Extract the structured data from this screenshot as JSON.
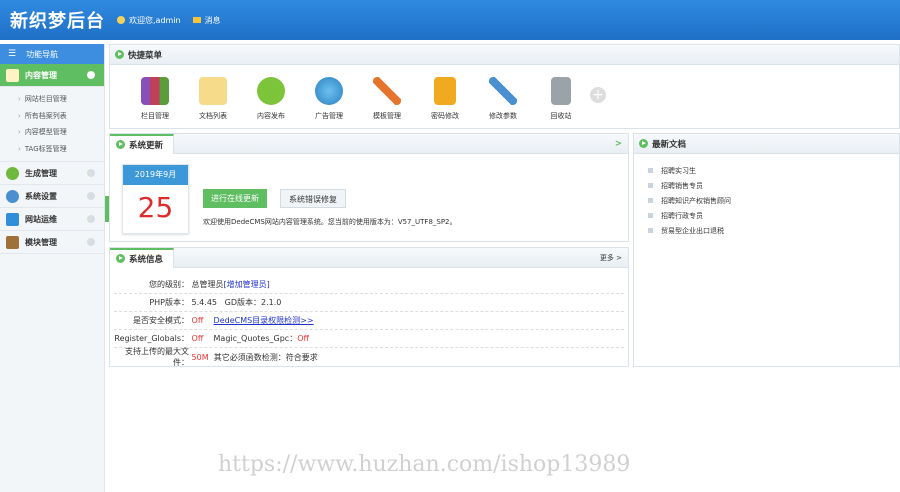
{
  "header": {
    "logo": "新织梦后台",
    "welcome": "欢迎您,admin",
    "messages": "消息"
  },
  "sidebar": {
    "title": "功能导航",
    "groups": [
      {
        "label": "内容管理",
        "items": [
          "网站栏目管理",
          "所有档案列表",
          "内容模型管理",
          "TAG标签管理"
        ]
      },
      {
        "label": "生成管理"
      },
      {
        "label": "系统设置"
      },
      {
        "label": "网站运维"
      },
      {
        "label": "模块管理"
      }
    ]
  },
  "quick": {
    "title": "快捷菜单",
    "items": [
      "栏目管理",
      "文档列表",
      "内容发布",
      "广告管理",
      "模板管理",
      "密码修改",
      "修改参数",
      "回收站"
    ],
    "add": "+"
  },
  "update": {
    "title": "系统更新",
    "more": ">",
    "month": "2019年9月",
    "day": "25",
    "online_btn": "进行在线更新",
    "fix_btn": "系统错误修复",
    "text": "欢迎使用DedeCMS网站内容管理系统。您当前的使用版本为：V57_UTF8_SP2。"
  },
  "sysinfo": {
    "title": "系统信息",
    "more": "更多 >",
    "rows": [
      {
        "k": "您的级别：",
        "v1": "总管理员 ",
        "link": "[增加管理员]"
      },
      {
        "k": "PHP版本：",
        "v1": "5.4.45   GD版本：2.1.0"
      },
      {
        "k": "是否安全模式：",
        "red": "Off",
        "link": "DedeCMS目录权限检测>>"
      },
      {
        "k": "Register_Globals：",
        "red": "Off",
        "v2": "Magic_Quotes_Gpc：",
        "red2": "Off"
      },
      {
        "k": "支持上传的最大文件：",
        "red": "50M",
        "v2": "其它必须函数检测：符合要求"
      }
    ]
  },
  "news": {
    "title": "最新文档",
    "items": [
      "招聘实习生",
      "招聘销售专员",
      "招聘知识产权销售顾问",
      "招聘行政专员",
      "贸易型企业出口退税"
    ]
  },
  "watermark": "https://www.huzhan.com/ishop13989"
}
